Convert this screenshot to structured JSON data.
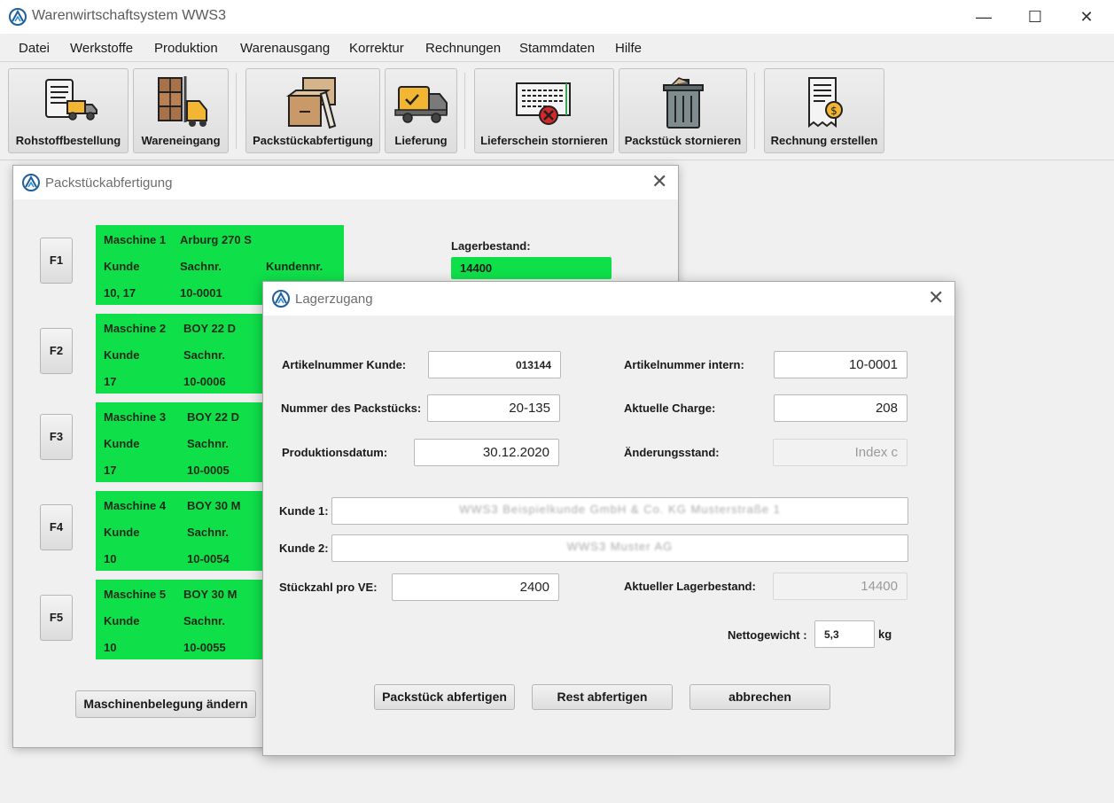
{
  "app": {
    "title": "Warenwirtschaftsystem WWS3"
  },
  "menu": [
    "Datei",
    "Werkstoffe",
    "Produktion",
    "Warenausgang",
    "Korrektur",
    "Rechnungen",
    "Stammdaten",
    "Hilfe"
  ],
  "toolbar": [
    {
      "label": "Rohstoffbestellung",
      "icon": "document-truck-icon"
    },
    {
      "label": "Wareneingang",
      "icon": "forklift-icon"
    },
    {
      "label": "Packstückabfertigung",
      "icon": "boxes-icon"
    },
    {
      "label": "Lieferung",
      "icon": "delivery-truck-icon"
    },
    {
      "label": "Lieferschein stornieren",
      "icon": "cancel-document-icon"
    },
    {
      "label": "Packstück stornieren",
      "icon": "trash-can-icon"
    },
    {
      "label": "Rechnung erstellen",
      "icon": "invoice-icon"
    }
  ],
  "packstueck_dialog": {
    "title": "Packstückabfertigung",
    "lagerbestand_label": "Lagerbestand:",
    "lagerbestand_value": "14400",
    "machines": [
      {
        "key": "F1",
        "name": "Maschine 1",
        "model": "Arburg 270 S",
        "kunde_label": "Kunde",
        "sachnr_label": "Sachnr.",
        "kundennr_label": "Kundennr.",
        "kunde": "10, 17",
        "sachnr": "10-0001"
      },
      {
        "key": "F2",
        "name": "Maschine 2",
        "model": "BOY 22 D",
        "kunde_label": "Kunde",
        "sachnr_label": "Sachnr.",
        "kunde": "17",
        "sachnr": "10-0006"
      },
      {
        "key": "F3",
        "name": "Maschine 3",
        "model": "BOY 22 D",
        "kunde_label": "Kunde",
        "sachnr_label": "Sachnr.",
        "kunde": "17",
        "sachnr": "10-0005"
      },
      {
        "key": "F4",
        "name": "Maschine 4",
        "model": "BOY 30 M",
        "kunde_label": "Kunde",
        "sachnr_label": "Sachnr.",
        "kunde": "10",
        "sachnr": "10-0054"
      },
      {
        "key": "F5",
        "name": "Maschine 5",
        "model": "BOY 30 M",
        "kunde_label": "Kunde",
        "sachnr_label": "Sachnr.",
        "kunde": "10",
        "sachnr": "10-0055"
      }
    ],
    "change_button": "Maschinenbelegung ändern"
  },
  "lagerzugang_dialog": {
    "title": "Lagerzugang",
    "artikelnummer_kunde": {
      "label": "Artikelnummer Kunde:",
      "value": "013144"
    },
    "artikelnummer_intern": {
      "label": "Artikelnummer intern:",
      "value": "10-0001"
    },
    "nummer_packstueck": {
      "label": "Nummer des Packstücks:",
      "value": "20-135"
    },
    "aktuelle_charge": {
      "label": "Aktuelle Charge:",
      "value": "208"
    },
    "produktionsdatum": {
      "label": "Produktionsdatum:",
      "value": "30.12.2020"
    },
    "aenderungsstand": {
      "label": "Änderungsstand:",
      "value": "Index c"
    },
    "kunde1": {
      "label": "Kunde 1:",
      "value": "WWS3 Beispielkunde GmbH & Co. KG Musterstraße 1"
    },
    "kunde2": {
      "label": "Kunde 2:",
      "value": "WWS3 Muster AG"
    },
    "stueckzahl": {
      "label": "Stückzahl pro VE:",
      "value": "2400"
    },
    "aktueller_lagerbestand": {
      "label": "Aktueller Lagerbestand:",
      "value": "14400"
    },
    "nettogewicht": {
      "label": "Nettogewicht :",
      "value": "5,3",
      "unit": "kg"
    },
    "buttons": {
      "abfertigen": "Packstück abfertigen",
      "rest": "Rest abfertigen",
      "abbrechen": "abbrechen"
    }
  },
  "colors": {
    "machine_green": "#0fe04a",
    "window_bg": "#f0f0f0"
  }
}
